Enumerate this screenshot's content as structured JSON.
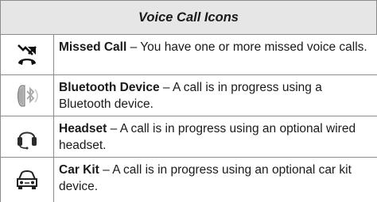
{
  "table": {
    "title": "Voice Call Icons",
    "rows": [
      {
        "icon": "missed-call-icon",
        "name": "Missed Call",
        "separator": " – ",
        "description": "You have one or more missed voice calls."
      },
      {
        "icon": "bluetooth-device-icon",
        "name": "Bluetooth Device",
        "separator": " – ",
        "description": "A call is in progress using a Bluetooth device."
      },
      {
        "icon": "headset-icon",
        "name": "Headset",
        "separator": " – ",
        "description": "A call is in progress using an optional wired headset."
      },
      {
        "icon": "car-kit-icon",
        "name": "Car Kit",
        "separator": " – ",
        "description": "A call is in progress using an optional car kit device."
      }
    ]
  }
}
